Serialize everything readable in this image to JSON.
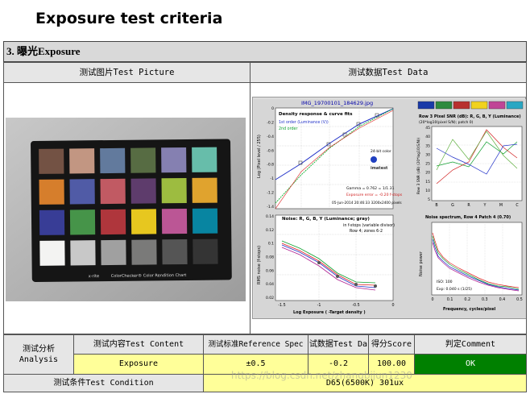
{
  "header": {
    "title": "Exposure test criteria"
  },
  "section": {
    "title": "3. 曝光Exposure"
  },
  "columns": {
    "picture": "测试图片Test Picture",
    "data": "测试数据Test Data"
  },
  "chart_panel": {
    "file_title": "IMG_19700101_184629.jpg",
    "density": {
      "title": "Density response & curve fits",
      "legend_1st": "1st order (Luminance (V))",
      "legend_2nd": "2nd order",
      "ylabel": "Log (Pixel level / 255)",
      "yticks": [
        "0",
        "-0.2",
        "-0.4",
        "-0.6",
        "-0.8",
        "-1",
        "-1.2",
        "-1.4"
      ],
      "logo_text": "24-bit color",
      "brand": "imatest",
      "gamma": "Gamma = 0.762 = 1/1.31",
      "exposure_error": "Exposure error = -0.20 f-stops",
      "date": "05-Jun-2014 20:46:33  3200x2400 pixels"
    },
    "snr": {
      "title": "Row 3 Pixel SNR (dB): R, G, B, Y (Luminance)",
      "subtitle": "(20*log10(pixel S/N); patch 0)",
      "ylabel": "Row 3 SNR (dB) (20*log10(S/N))",
      "yticks": [
        "45",
        "40",
        "35",
        "30",
        "25",
        "20",
        "15",
        "10",
        "5"
      ],
      "xticks": [
        "B",
        "G",
        "R",
        "Y",
        "M",
        "C"
      ],
      "swatches": [
        "#1a3aa8",
        "#2e8a3e",
        "#b8302e",
        "#f0d21e",
        "#c04696",
        "#2aa7c3"
      ]
    },
    "noise": {
      "title": "Noise: R, G, B, Y (Luminance; gray)",
      "subtitle": "in f-stops (variable divisor)",
      "subtitle2": "Row 4; zones 6-2",
      "ylabel": "RMS noise (f-stops)",
      "xlabel": "Log Exposure ( -Target density )",
      "yticks": [
        "0.14",
        "0.12",
        "0.1",
        "0.08",
        "0.06",
        "0.04",
        "0.02"
      ],
      "xticks": [
        "-1.5",
        "-1",
        "-0.5",
        "0"
      ]
    },
    "spectrum": {
      "title": "Noise spectrum, Row 4 Patch 4 (0.70)",
      "ylabel": "Noise power",
      "xlabel": "Frequency, cycles/pixel",
      "xticks": [
        "0",
        "0.1",
        "0.2",
        "0.3",
        "0.4",
        "0.5"
      ],
      "iso": "ISO:    100",
      "exp": "Exp:  0.040 s  (1/25)"
    }
  },
  "photo": {
    "brand": "x-rite",
    "chart_name": "ColorChecker® Color Rendition Chart"
  },
  "analysis": {
    "label_cn": "测试分析",
    "label_en": "Analysis",
    "headers": {
      "content": "测试内容Test Content",
      "spec": "测试标准Reference Spec",
      "data": "试数据Test Da",
      "score": "得分Score",
      "comment": "判定Comment"
    },
    "row": {
      "content": "Exposure",
      "spec": "±0.5",
      "data": "-0.2",
      "score": "100.00",
      "comment": "OK"
    }
  },
  "condition": {
    "label": "测试条件Test Condition",
    "value": "D65(6500K) 301ux"
  },
  "watermark": "https://blog.csdn.net/zhangbijun1230",
  "colors": {
    "ok_green": "#008000",
    "value_yellow": "#ffff99",
    "section_gray": "#d9d9d9"
  },
  "checker_patches": [
    "#735244",
    "#c29682",
    "#627a9d",
    "#576c43",
    "#8580b1",
    "#67bdaa",
    "#d67e2c",
    "#505ba6",
    "#c15a63",
    "#5e3c6c",
    "#9dbc40",
    "#e0a32e",
    "#383d96",
    "#469449",
    "#af363c",
    "#e7c71f",
    "#bb5695",
    "#0885a1",
    "#f3f3f2",
    "#c8c8c8",
    "#a0a0a0",
    "#7a7a79",
    "#555555",
    "#343434"
  ]
}
